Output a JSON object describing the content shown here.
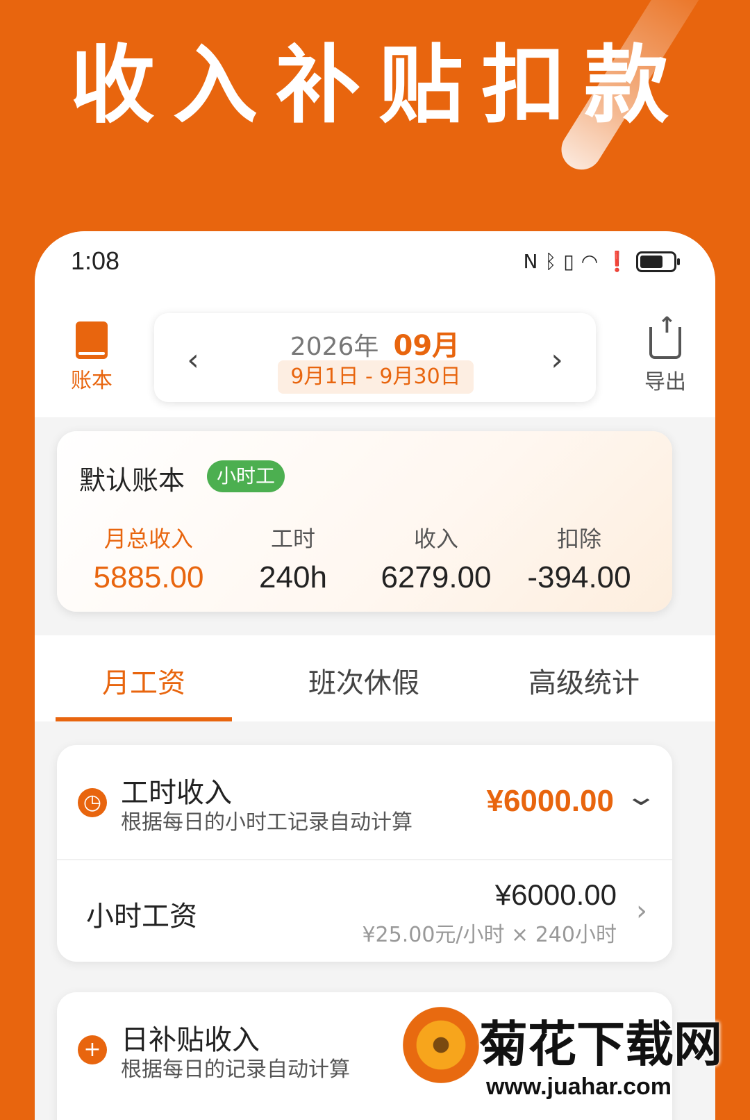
{
  "banner": {
    "title": "收入补贴扣款"
  },
  "status": {
    "time": "1:08",
    "icons": [
      "nfc-icon",
      "bluetooth-icon",
      "vibrate-icon",
      "wifi-icon",
      "alert-icon",
      "battery-icon"
    ]
  },
  "header": {
    "ledger_label": "账本",
    "year": "2026年",
    "month": "09月",
    "range": "9月1日 - 9月30日",
    "prev_arrow": "‹",
    "next_arrow": "›",
    "export_label": "导出"
  },
  "summary": {
    "book_name": "默认账本",
    "tag": "小时工",
    "stats": [
      {
        "label": "月总收入",
        "value": "5885.00"
      },
      {
        "label": "工时",
        "value": "240h"
      },
      {
        "label": "收入",
        "value": "6279.00"
      },
      {
        "label": "扣除",
        "value": "-394.00"
      }
    ]
  },
  "tabs": [
    {
      "label": "月工资",
      "active": true
    },
    {
      "label": "班次休假",
      "active": false
    },
    {
      "label": "高级统计",
      "active": false
    }
  ],
  "hour_income": {
    "title": "工时收入",
    "subtitle": "根据每日的小时工记录自动计算",
    "amount": "¥6000.00",
    "row_label": "小时工资",
    "row_amount": "¥6000.00",
    "row_detail": "¥25.00元/小时 × 240小时"
  },
  "daily_subsidy": {
    "title": "日补贴收入",
    "subtitle": "根据每日的记录自动计算"
  },
  "watermark": {
    "title": "菊花下载网",
    "url": "www.juahar.com"
  },
  "colors": {
    "accent": "#E8650E",
    "tag_green": "#4CAF50"
  }
}
